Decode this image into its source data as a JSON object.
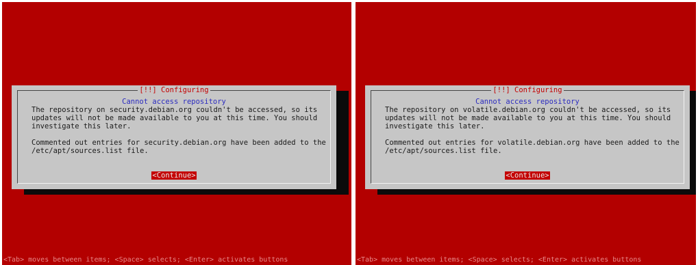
{
  "left": {
    "title": "[!!] Configuring",
    "subtitle": "Cannot access repository",
    "message": "The repository on security.debian.org couldn't be accessed, so its\nupdates will not be made available to you at this time. You should\ninvestigate this later.\n\nCommented out entries for security.debian.org have been added to the\n/etc/apt/sources.list file.",
    "button": "<Continue>",
    "footer": "<Tab> moves between items; <Space> selects; <Enter> activates buttons"
  },
  "right": {
    "title": "[!!] Configuring",
    "subtitle": "Cannot access repository",
    "message": "The repository on volatile.debian.org couldn't be accessed, so its\nupdates will not be made available to you at this time. You should\ninvestigate this later.\n\nCommented out entries for volatile.debian.org have been added to the\n/etc/apt/sources.list file.",
    "button": "<Continue>",
    "footer": "<Tab> moves between items; <Space> selects; <Enter> activates buttons"
  },
  "colors": {
    "background": "#b30000",
    "dialog": "#c6c6c6",
    "title": "#c40000",
    "subtitle": "#2c2cc0",
    "button_bg": "#c40000",
    "button_text": "#e8e8e8"
  }
}
